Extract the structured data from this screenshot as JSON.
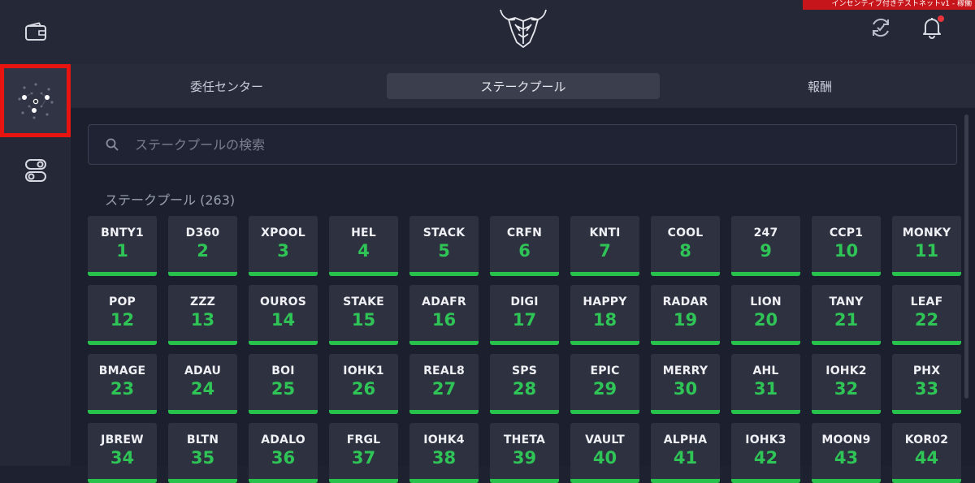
{
  "header": {
    "banner_text": "インセンティブ付きテストネットv1 - 稼働"
  },
  "tabs": [
    {
      "label": "委任センター",
      "active": false
    },
    {
      "label": "ステークプール",
      "active": true
    },
    {
      "label": "報酬",
      "active": false
    }
  ],
  "search": {
    "placeholder": "ステークプールの検索",
    "value": ""
  },
  "pools": {
    "title": "ステークプール (263)",
    "items": [
      {
        "ticker": "BNTY1",
        "rank": "1"
      },
      {
        "ticker": "D360",
        "rank": "2"
      },
      {
        "ticker": "XPOOL",
        "rank": "3"
      },
      {
        "ticker": "HEL",
        "rank": "4"
      },
      {
        "ticker": "STACK",
        "rank": "5"
      },
      {
        "ticker": "CRFN",
        "rank": "6"
      },
      {
        "ticker": "KNTI",
        "rank": "7"
      },
      {
        "ticker": "COOL",
        "rank": "8"
      },
      {
        "ticker": "247",
        "rank": "9"
      },
      {
        "ticker": "CCP1",
        "rank": "10"
      },
      {
        "ticker": "MONKY",
        "rank": "11"
      },
      {
        "ticker": "POP",
        "rank": "12"
      },
      {
        "ticker": "ZZZ",
        "rank": "13"
      },
      {
        "ticker": "OUROS",
        "rank": "14"
      },
      {
        "ticker": "STAKE",
        "rank": "15"
      },
      {
        "ticker": "ADAFR",
        "rank": "16"
      },
      {
        "ticker": "DIGI",
        "rank": "17"
      },
      {
        "ticker": "HAPPY",
        "rank": "18"
      },
      {
        "ticker": "RADAR",
        "rank": "19"
      },
      {
        "ticker": "LION",
        "rank": "20"
      },
      {
        "ticker": "TANY",
        "rank": "21"
      },
      {
        "ticker": "LEAF",
        "rank": "22"
      },
      {
        "ticker": "BMAGE",
        "rank": "23"
      },
      {
        "ticker": "ADAU",
        "rank": "24"
      },
      {
        "ticker": "BOI",
        "rank": "25"
      },
      {
        "ticker": "IOHK1",
        "rank": "26"
      },
      {
        "ticker": "REAL8",
        "rank": "27"
      },
      {
        "ticker": "SPS",
        "rank": "28"
      },
      {
        "ticker": "EPIC",
        "rank": "29"
      },
      {
        "ticker": "MERRY",
        "rank": "30"
      },
      {
        "ticker": "AHL",
        "rank": "31"
      },
      {
        "ticker": "IOHK2",
        "rank": "32"
      },
      {
        "ticker": "PHX",
        "rank": "33"
      },
      {
        "ticker": "JBREW",
        "rank": "34"
      },
      {
        "ticker": "BLTN",
        "rank": "35"
      },
      {
        "ticker": "ADALO",
        "rank": "36"
      },
      {
        "ticker": "FRGL",
        "rank": "37"
      },
      {
        "ticker": "IOHK4",
        "rank": "38"
      },
      {
        "ticker": "THETA",
        "rank": "39"
      },
      {
        "ticker": "VAULT",
        "rank": "40"
      },
      {
        "ticker": "ALPHA",
        "rank": "41"
      },
      {
        "ticker": "IOHK3",
        "rank": "42"
      },
      {
        "ticker": "MOON9",
        "rank": "43"
      },
      {
        "ticker": "KOR02",
        "rank": "44"
      }
    ]
  },
  "icons": {
    "sidebar_wallet": "wallet-icon",
    "sidebar_staking": "staking-icon",
    "sidebar_settings": "toggle-settings-icon",
    "header_logo": "bull-logo-icon",
    "header_sync": "sync-icon",
    "header_bell": "bell-icon",
    "search": "search-icon"
  },
  "colors": {
    "accent_green": "#2fc456",
    "highlight_red": "#e8140f",
    "notification_dot": "#e8353c"
  }
}
